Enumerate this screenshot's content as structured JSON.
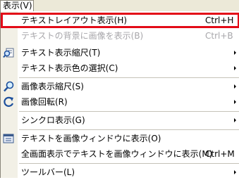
{
  "menubar": {
    "title": "表示(V)"
  },
  "menu": {
    "items": [
      {
        "label": "テキストレイアウト表示(H)",
        "shortcut": "Ctrl+H",
        "state": "highlighted"
      },
      {
        "label": "テキストの背景に画像を表示(B)",
        "shortcut": "Ctrl+B",
        "state": "disabled"
      },
      {
        "label": "テキスト表示縮尺(T)",
        "submenu": true,
        "icon": "zoom-text-icon"
      },
      {
        "label": "テキスト表示色の選択(C)",
        "submenu": true
      },
      {
        "label": "画像表示縮尺(S)",
        "submenu": true,
        "icon": "magnifier-icon"
      },
      {
        "label": "画像回転(R)",
        "submenu": true,
        "icon": "rotate-icon"
      },
      {
        "label": "シンクロ表示(G)",
        "submenu": true
      },
      {
        "label": "テキストを画像ウィンドウに表示(O)",
        "icon": "text-window-icon"
      },
      {
        "label": "全画面表示でテキストを画像ウィンドウに表示(M)",
        "shortcut": "Ctrl+M"
      },
      {
        "label": "ツールバー(L)",
        "submenu": true
      }
    ]
  },
  "colors": {
    "highlight_border": "#e30b17",
    "disabled_text": "#a7a6aa",
    "gutter": "#f2f0e6"
  }
}
